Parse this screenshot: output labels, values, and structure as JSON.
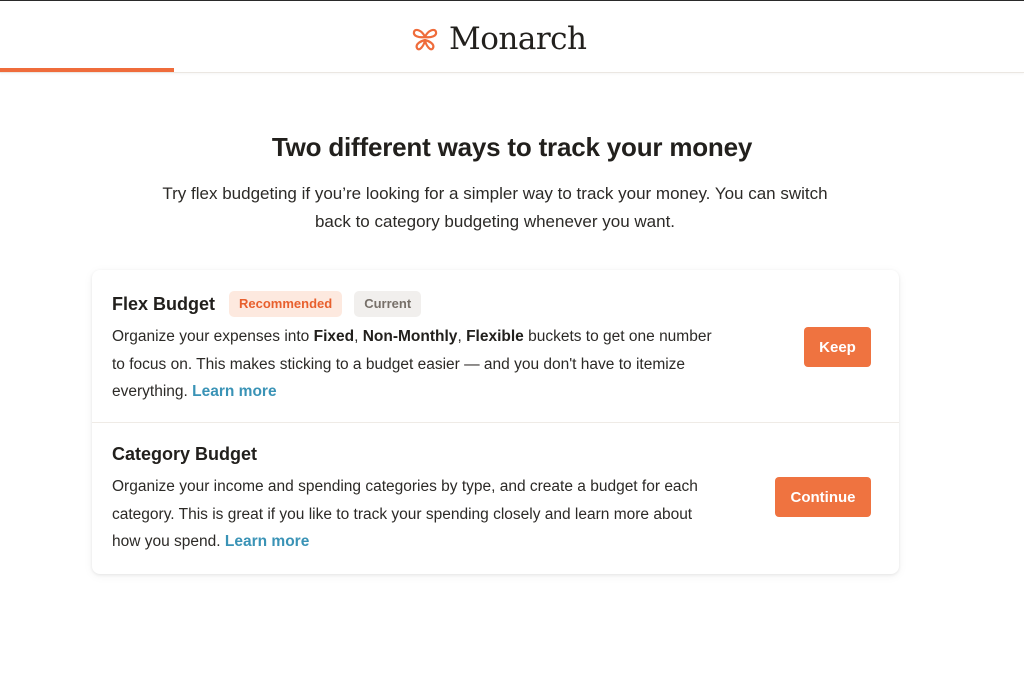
{
  "brand": {
    "name": "Monarch",
    "icon": "butterfly-icon",
    "accent": "#ef6c3b"
  },
  "onboarding": {
    "progress_fraction": 0.17
  },
  "page": {
    "title": "Two different ways to track your money",
    "subtitle": "Try flex budgeting if you’re looking for a simpler way to track your money. You can switch back to category budgeting whenever you want."
  },
  "options": {
    "flex": {
      "title": "Flex Budget",
      "badge_recommended": "Recommended",
      "badge_current": "Current",
      "desc_part1": "Organize your expenses into ",
      "desc_fixed": "Fixed",
      "desc_sep1": ", ",
      "desc_nonmonthly": "Non-Monthly",
      "desc_sep2": ", ",
      "desc_flexible": "Flexible",
      "desc_part2": " buckets to get one number to focus on. This makes sticking to a budget easier — and you don't have to itemize everything. ",
      "learn_more": "Learn more",
      "button": "Keep"
    },
    "category": {
      "title": "Category Budget",
      "desc": "Organize your income and spending categories by type, and create a budget for each category. This is great if you like to track your spending closely and learn more about how you spend. ",
      "learn_more": "Learn more",
      "button": "Continue"
    }
  },
  "colors": {
    "button": "#ef7340",
    "link": "#3a93b6",
    "badge_recommended_bg": "#fde9df",
    "badge_recommended_text": "#e8602e",
    "badge_current_bg": "#f1efed"
  }
}
